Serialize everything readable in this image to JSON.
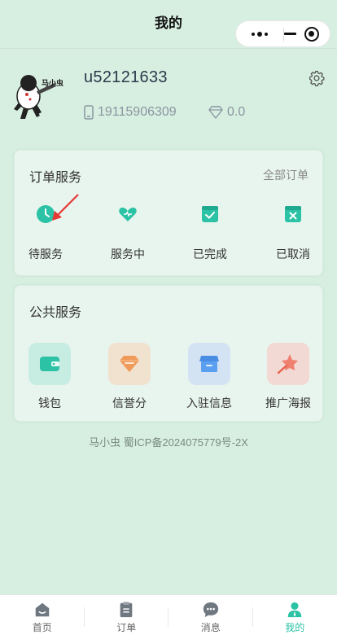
{
  "navbar": {
    "title": "我的"
  },
  "profile": {
    "username": "u52121633",
    "phone": "19115906309",
    "points": "0.0",
    "avatar_text": "马小虫"
  },
  "orders": {
    "title": "订单服务",
    "all_label": "全部订单",
    "items": [
      {
        "label": "待服务",
        "icon": "clock-icon"
      },
      {
        "label": "服务中",
        "icon": "heart-icon"
      },
      {
        "label": "已完成",
        "icon": "check-calendar-icon"
      },
      {
        "label": "已取消",
        "icon": "cancel-calendar-icon"
      }
    ]
  },
  "public": {
    "title": "公共服务",
    "items": [
      {
        "label": "钱包",
        "icon": "wallet-icon"
      },
      {
        "label": "信誉分",
        "icon": "diamond-icon"
      },
      {
        "label": "入驻信息",
        "icon": "store-icon"
      },
      {
        "label": "推广海报",
        "icon": "star-wand-icon"
      }
    ]
  },
  "footer": {
    "icp": "马小虫 蜀ICP备2024075779号-2X"
  },
  "tabbar": {
    "items": [
      {
        "label": "首页",
        "icon": "home-icon",
        "active": false
      },
      {
        "label": "订单",
        "icon": "clipboard-icon",
        "active": false
      },
      {
        "label": "消息",
        "icon": "chat-icon",
        "active": false
      },
      {
        "label": "我的",
        "icon": "user-icon",
        "active": true
      }
    ]
  },
  "colors": {
    "background": "#d7efe1",
    "accent": "#2bc2a5",
    "card": "#e8f5ee"
  }
}
